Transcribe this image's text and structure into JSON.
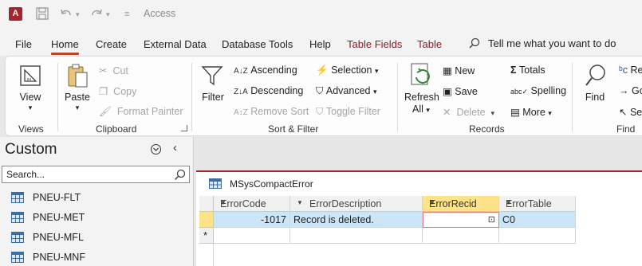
{
  "titlebar": {
    "app_logo_letter": "A",
    "title": "Access"
  },
  "tabs": {
    "file": "File",
    "home": "Home",
    "create": "Create",
    "external_data": "External Data",
    "database_tools": "Database Tools",
    "help": "Help",
    "table_fields": "Table Fields",
    "table": "Table",
    "tell_me": "Tell me what you want to do"
  },
  "ribbon": {
    "views": {
      "view": "View",
      "group": "Views"
    },
    "clipboard": {
      "paste": "Paste",
      "cut": "Cut",
      "copy": "Copy",
      "format_painter": "Format Painter",
      "group": "Clipboard"
    },
    "sort_filter": {
      "filter": "Filter",
      "ascending": "Ascending",
      "descending": "Descending",
      "remove_sort": "Remove Sort",
      "selection": "Selection",
      "advanced": "Advanced",
      "toggle_filter": "Toggle Filter",
      "group": "Sort & Filter"
    },
    "records": {
      "refresh": "Refresh",
      "refresh_all": "All",
      "new": "New",
      "save": "Save",
      "delete": "Delete",
      "totals": "Totals",
      "spelling": "Spelling",
      "more": "More",
      "group": "Records"
    },
    "find": {
      "find": "Find",
      "replace": "Re",
      "goto": "Go",
      "select": "Se",
      "group": "Find"
    }
  },
  "nav": {
    "title": "Custom",
    "search_placeholder": "Search...",
    "items": [
      {
        "label": "PNEU-FLT"
      },
      {
        "label": "PNEU-MET"
      },
      {
        "label": "PNEU-MFL"
      },
      {
        "label": "PNEU-MNF"
      }
    ]
  },
  "datasheet": {
    "tab_title": "MSysCompactError",
    "columns": [
      "ErrorCode",
      "ErrorDescription",
      "ErrorRecid",
      "ErrorTable"
    ],
    "rows": [
      {
        "ErrorCode": "-1017",
        "ErrorDescription": "Record is deleted.",
        "ErrorRecid": "",
        "ErrorTable": "C0"
      }
    ],
    "new_row_marker": "*"
  },
  "colors": {
    "accent": "#a4262c",
    "tab_underline": "#b7472a",
    "selected_header": "#ffe38a",
    "selected_row": "#cde6f7"
  }
}
